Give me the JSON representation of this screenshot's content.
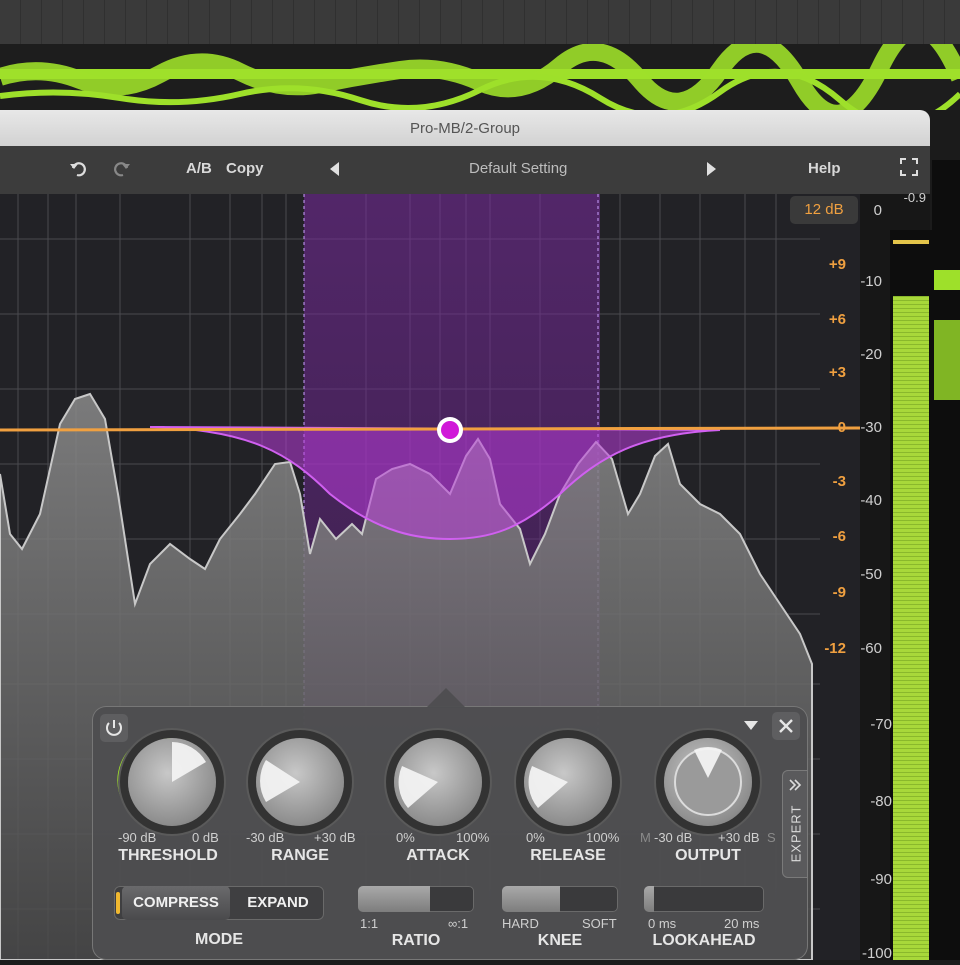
{
  "window_title": "Pro-MB/2-Group",
  "toolbar": {
    "ab": "A/B",
    "copy": "Copy",
    "preset": "Default Setting",
    "help": "Help"
  },
  "range_button": "12 dB",
  "meter_top": "0",
  "meter_peak": "-0.9",
  "gain_scale": [
    "+9",
    "+6",
    "+3",
    "0",
    "-3",
    "-6",
    "-9",
    "-12"
  ],
  "level_scale": [
    "-10",
    "-20",
    "-30",
    "-40",
    "-50",
    "-60",
    "-70",
    "-80",
    "-90",
    "-100"
  ],
  "band_panel": {
    "threshold": {
      "label": "THRESHOLD",
      "min": "-90 dB",
      "max": "0 dB"
    },
    "range": {
      "label": "RANGE",
      "min": "-30 dB",
      "max": "+30 dB"
    },
    "attack": {
      "label": "ATTACK",
      "min": "0%",
      "max": "100%"
    },
    "release": {
      "label": "RELEASE",
      "min": "0%",
      "max": "100%"
    },
    "output": {
      "label": "OUTPUT",
      "min": "-30 dB",
      "max": "+30 dB",
      "left_letter": "M",
      "right_letter": "S"
    },
    "mode": {
      "label": "MODE",
      "compress": "COMPRESS",
      "expand": "EXPAND"
    },
    "ratio": {
      "label": "RATIO",
      "min": "1:1",
      "max": "∞:1",
      "level": 0.62
    },
    "knee": {
      "label": "KNEE",
      "min": "HARD",
      "max": "SOFT",
      "level": 0.5
    },
    "lookahead": {
      "label": "LOOKAHEAD",
      "min": "0 ms",
      "max": "20 ms",
      "level": 0.08
    },
    "expert": "EXPERT"
  },
  "colors": {
    "accent": "#c030e0",
    "orange": "#f0a040",
    "meter_green": "#a8d83a",
    "wave_green": "#9ee02a"
  }
}
